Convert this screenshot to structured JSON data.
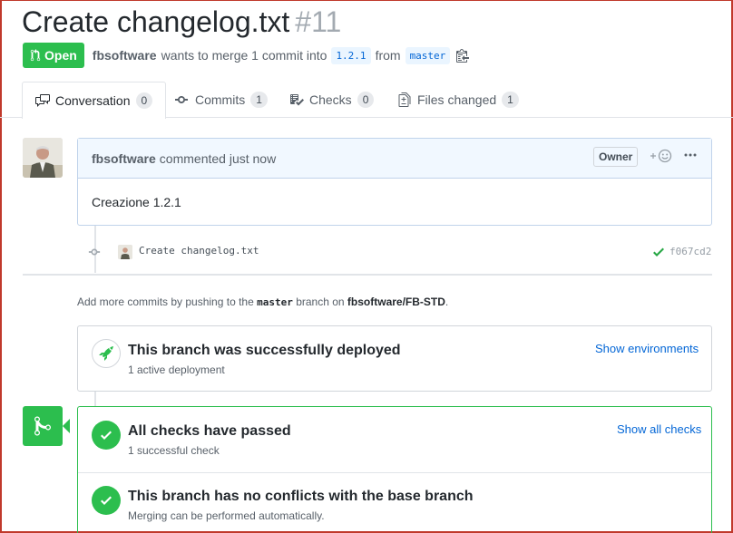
{
  "pr": {
    "title": "Create changelog.txt",
    "number": "#11",
    "state_label": "Open",
    "author": "fbsoftware",
    "merge_text": "wants to merge 1 commit into",
    "base_branch": "1.2.1",
    "from_text": "from",
    "head_branch": "master"
  },
  "tabs": [
    {
      "label": "Conversation",
      "count": "0",
      "icon": "comment-discussion-icon"
    },
    {
      "label": "Commits",
      "count": "1",
      "icon": "git-commit-icon"
    },
    {
      "label": "Checks",
      "count": "0",
      "icon": "checklist-icon"
    },
    {
      "label": "Files changed",
      "count": "1",
      "icon": "diff-icon"
    }
  ],
  "comment": {
    "author": "fbsoftware",
    "action": "commented just now",
    "role_badge": "Owner",
    "body": "Creazione 1.2.1"
  },
  "commit": {
    "message": "Create changelog.txt",
    "sha": "f067cd2",
    "status": "success"
  },
  "hint": {
    "prefix": "Add more commits by pushing to the",
    "branch": "master",
    "middle": "branch on",
    "repo": "fbsoftware/FB-STD",
    "suffix": "."
  },
  "deployment": {
    "title": "This branch was successfully deployed",
    "subtitle": "1 active deployment",
    "link": "Show environments"
  },
  "checks": {
    "title": "All checks have passed",
    "subtitle": "1 successful check",
    "link": "Show all checks"
  },
  "conflicts": {
    "title": "This branch has no conflicts with the base branch",
    "subtitle": "Merging can be performed automatically."
  },
  "colors": {
    "green": "#2cbe4e",
    "link_blue": "#0366d6",
    "frame_red": "#c0392b"
  }
}
